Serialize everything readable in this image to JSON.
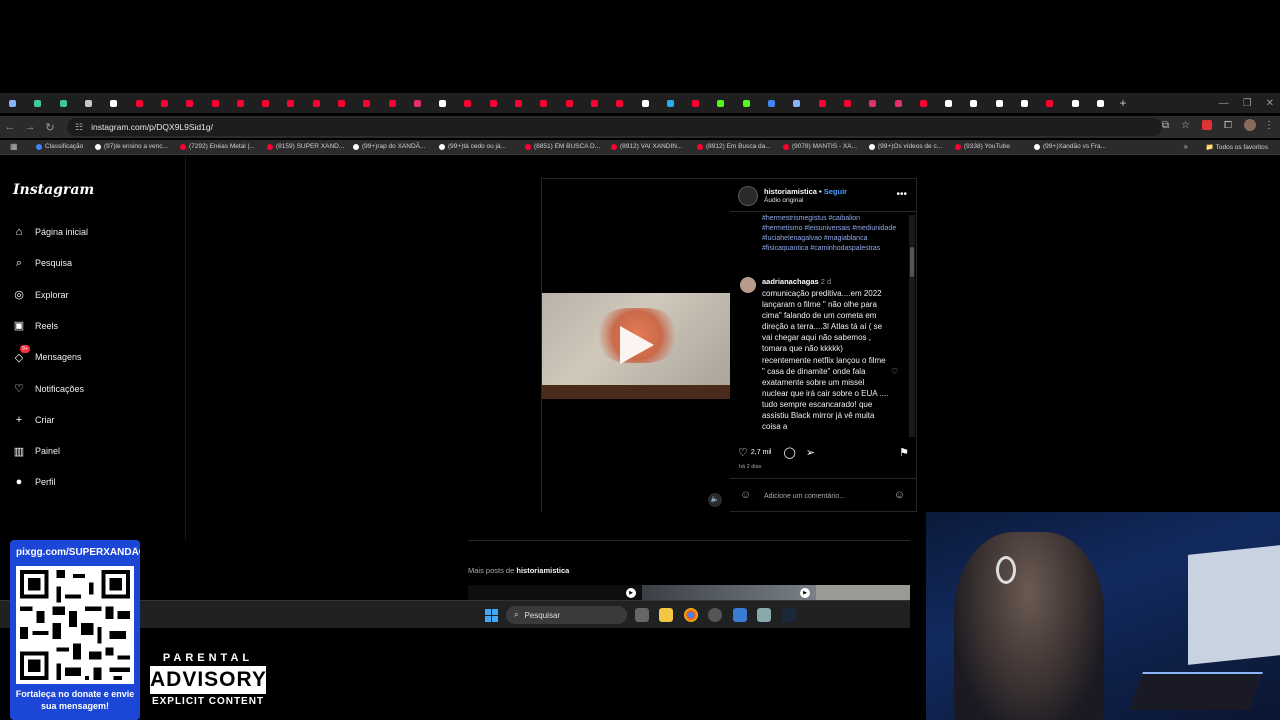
{
  "browser": {
    "tab_colors": [
      "#8ab4f8",
      "#3ec9a0",
      "#3ec9a0",
      "#c7c7c7",
      "#ffffff",
      "#ff0033",
      "#ff0033",
      "#ff0033",
      "#ff0033",
      "#ff0033",
      "#ff0033",
      "#ff0033",
      "#ff0033",
      "#ff0033",
      "#ff0033",
      "#ff0033",
      "#e1306c",
      "#ffffff",
      "#ff0033",
      "#ff0033",
      "#ff0033",
      "#ff0033",
      "#ff0033",
      "#ff0033",
      "#ff0033",
      "#ffffff",
      "#2aabee",
      "#ff0033",
      "#53fc18",
      "#53fc18",
      "#4285f4",
      "#8ab4f8",
      "#ff0033",
      "#ff0033",
      "#e1306c",
      "#e1306c",
      "#ff0033",
      "#ffffff",
      "#ffffff",
      "#ffffff",
      "#ffffff",
      "#ff0033",
      "#ffffff",
      "#ffffff"
    ],
    "url": "instagram.com/p/DQX9L9Sid1g/",
    "bookmarks": [
      {
        "label": "Classificação",
        "color": "#4285f4"
      },
      {
        "label": "(97)le ensino a venc...",
        "color": "#ffffff"
      },
      {
        "label": "(7292) Enéas Metal |...",
        "color": "#ff0033"
      },
      {
        "label": "(8159) SUPER XAND...",
        "color": "#ff0033"
      },
      {
        "label": "(99+)rap do XANDÃ...",
        "color": "#ffffff"
      },
      {
        "label": "(99+)tá cedo ou já...",
        "color": "#ffffff"
      },
      {
        "label": "(8851) EM BUSCA D...",
        "color": "#ff0033"
      },
      {
        "label": "(8912) VAI XANDIN...",
        "color": "#ff0033"
      },
      {
        "label": "(8912) Em Busca da...",
        "color": "#ff0033"
      },
      {
        "label": "(9078) MANTIS - XA...",
        "color": "#ff0033"
      },
      {
        "label": "(99+)Os vídeos de c...",
        "color": "#ffffff"
      },
      {
        "label": "(9338) YouTube",
        "color": "#ff0033"
      },
      {
        "label": "(99+)Xandão vs Fra...",
        "color": "#ffffff"
      }
    ],
    "all_bookmarks": "Todos os favoritos"
  },
  "instagram": {
    "logo": "Instagram",
    "nav": [
      {
        "label": "Página inicial",
        "icon": "home-icon"
      },
      {
        "label": "Pesquisa",
        "icon": "search-icon"
      },
      {
        "label": "Explorar",
        "icon": "compass-icon"
      },
      {
        "label": "Reels",
        "icon": "reels-icon"
      },
      {
        "label": "Mensagens",
        "icon": "messenger-icon",
        "badge": "9+"
      },
      {
        "label": "Notificações",
        "icon": "heart-icon"
      },
      {
        "label": "Criar",
        "icon": "plus-icon"
      },
      {
        "label": "Painel",
        "icon": "dashboard-icon"
      },
      {
        "label": "Perfil",
        "icon": "avatar-icon"
      }
    ],
    "post": {
      "username": "historiamistica",
      "follow": "Seguir",
      "audio": "Áudio original",
      "hashtags": "#hermestrismegistus #caibalion #hermetismo #leisuniversais #mediunidade #luciahelenagalvao #magiablanca #fisicaquantica #caminhodaspalestras",
      "comment_user": "aadrianachagas",
      "comment_time": "2 d",
      "comment_text": "comunicação preditiva....em 2022 lançaram o filme \" não olhe para cima\" falando de um cometa em direção a terra....3I Atlas tá aí ( se vai chegar aqui não sabemos , tomara que não kkkkk) recentemente netflix lançou o filme \" casa de dinamite\" onde fala exatamente sobre um missel nuclear que irá cair sobre o EUA .... tudo sempre escancarado! que assistiu Black mirror já vê muita coisa a",
      "likes": "2,7 mil",
      "date": "há 2 dias",
      "comment_placeholder": "Adicione um comentário..."
    },
    "more_posts_prefix": "Mais posts de ",
    "more_posts_user": "historiamistica"
  },
  "taskbar": {
    "search_placeholder": "Pesquisar"
  },
  "overlay": {
    "donate_url": "pixgg.com/SUPERXANDÃO",
    "donate_caption": "Fortaleça no donate e envie sua mensagem!",
    "parental_1": "PARENTAL",
    "parental_2": "ADVISORY",
    "parental_3": "EXPLICIT CONTENT"
  }
}
